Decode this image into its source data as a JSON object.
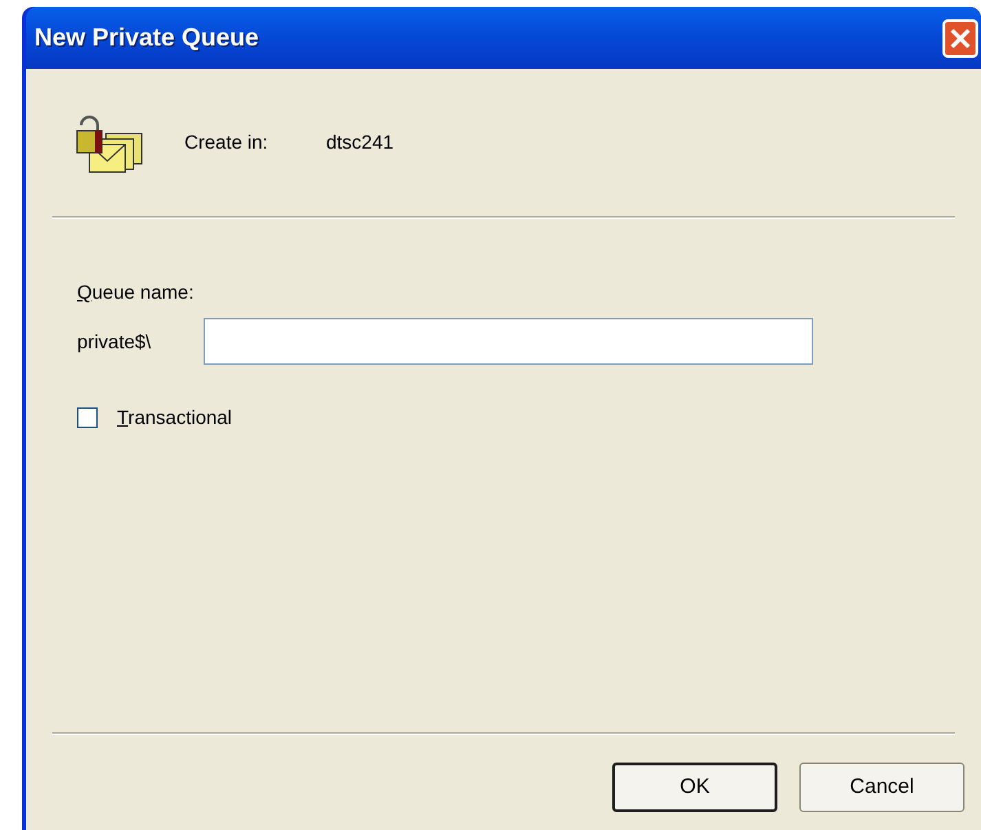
{
  "window": {
    "title": "New Private Queue"
  },
  "create_in": {
    "label": "Create in:",
    "value": "dtsc241"
  },
  "queue_name": {
    "label": "Queue name:",
    "prefix": "private$\\"
  },
  "transactional": {
    "label": "Transactional",
    "checked": false
  },
  "buttons": [
    {
      "label": "OK",
      "default": true
    },
    {
      "label": "Cancel",
      "default": false
    }
  ]
}
